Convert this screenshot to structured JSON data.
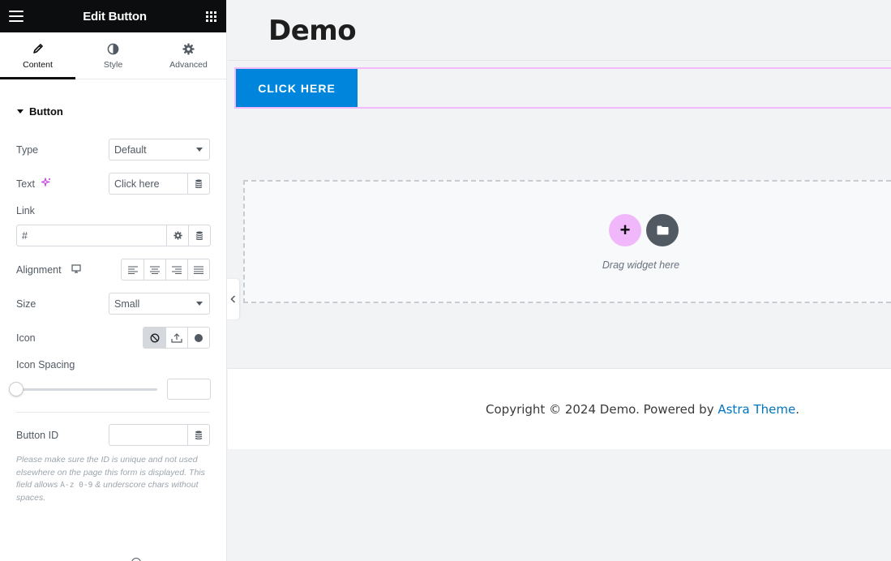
{
  "panel": {
    "title": "Edit Button",
    "tabs": [
      {
        "label": "Content",
        "icon": "pencil-icon"
      },
      {
        "label": "Style",
        "icon": "half-circle-icon"
      },
      {
        "label": "Advanced",
        "icon": "gear-icon"
      }
    ],
    "section": "Button",
    "fields": {
      "type_label": "Type",
      "type_value": "Default",
      "text_label": "Text",
      "text_value": "Click here",
      "link_label": "Link",
      "link_value": "#",
      "alignment_label": "Alignment",
      "size_label": "Size",
      "size_value": "Small",
      "icon_label": "Icon",
      "icon_spacing_label": "Icon Spacing",
      "button_id_label": "Button ID",
      "help_part1": "Please make sure the ID is unique and not used elsewhere on the page this form is displayed. This field allows",
      "help_code": "A-z 0-9",
      "help_part2": "& underscore chars without spaces."
    }
  },
  "preview": {
    "page_title": "Demo",
    "cta_label": "CLICK HERE",
    "dropzone_text": "Drag widget here",
    "footer_prefix": "Copyright © 2024 Demo. Powered by",
    "footer_link": "Astra Theme",
    "footer_suffix": "."
  },
  "colors": {
    "accent_blue": "#0085dc",
    "selection_pink": "#f3bafd",
    "add_pink": "#f0b7fb",
    "ai_magenta": "#c32fe0",
    "link_blue": "#0274be"
  }
}
